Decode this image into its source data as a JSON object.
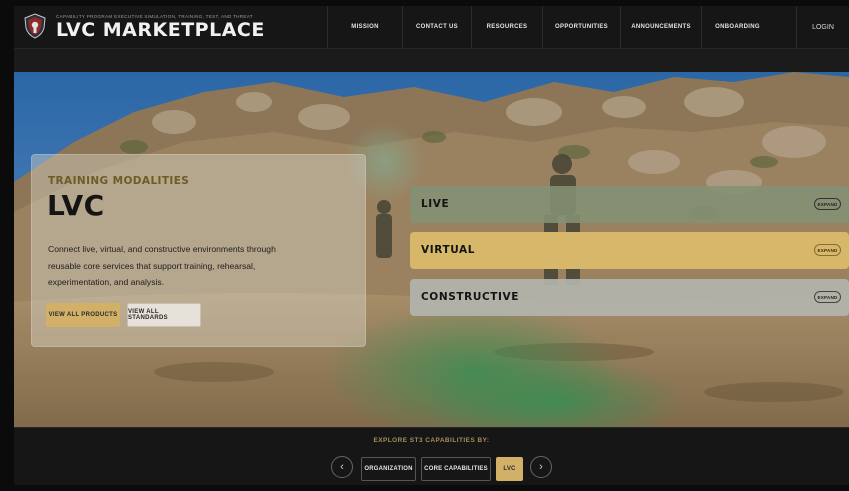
{
  "header": {
    "tagline": "CAPABILITY PROGRAM EXECUTIVE SIMULATION, TRAINING, TEST, AND THREAT",
    "title": "LVC MARKETPLACE",
    "nav": [
      {
        "label": "MISSION"
      },
      {
        "label": "CONTACT US"
      },
      {
        "label": "RESOURCES"
      },
      {
        "label": "OPPORTUNITIES"
      },
      {
        "label": "ANNOUNCEMENTS"
      },
      {
        "label": "ONBOARDING"
      }
    ],
    "login_label": "LOGIN"
  },
  "card": {
    "eyebrow": "TRAINING MODALITIES",
    "title": "LVC",
    "body": "Connect live, virtual, and constructive environments through reusable core services that support training, rehearsal, experimentation, and analysis.",
    "primary_button": "VIEW ALL PRODUCTS",
    "secondary_button": "VIEW ALL STANDARDS"
  },
  "accordion": [
    {
      "label": "LIVE",
      "action": "EXPAND"
    },
    {
      "label": "VIRTUAL",
      "action": "EXPAND"
    },
    {
      "label": "CONSTRUCTIVE",
      "action": "EXPAND"
    }
  ],
  "footer": {
    "explore_label": "EXPLORE ST3 CAPABILITIES BY:",
    "prev_glyph": "‹",
    "next_glyph": "›",
    "tags": [
      {
        "label": "ORGANIZATION",
        "active": false
      },
      {
        "label": "CORE CAPABILITIES",
        "active": false
      },
      {
        "label": "LVC",
        "active": true
      }
    ]
  },
  "colors": {
    "accent_gold": "#d2b068",
    "live_green": "#849174",
    "constructive_gray": "#b2b4ac",
    "background": "#141414"
  }
}
